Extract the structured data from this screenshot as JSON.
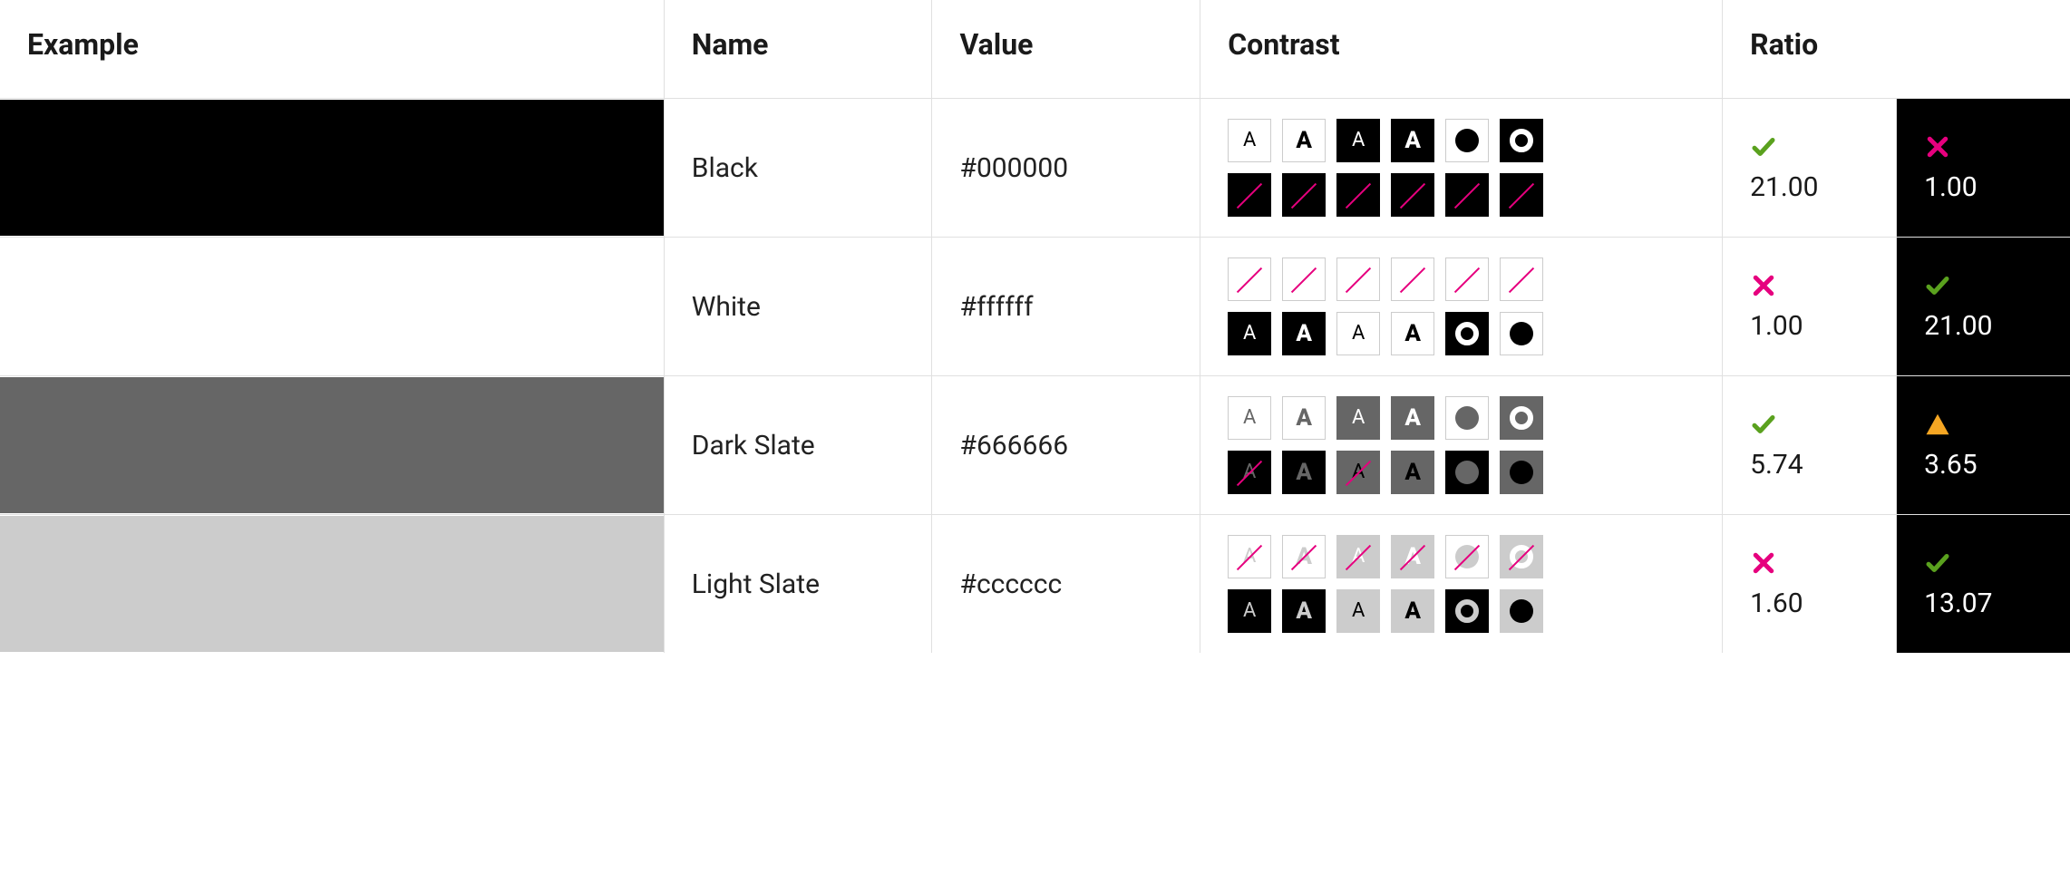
{
  "headers": {
    "example": "Example",
    "name": "Name",
    "value": "Value",
    "contrast": "Contrast",
    "ratio": "Ratio"
  },
  "status_colors": {
    "pass": "#5aa11e",
    "fail": "#e6007e",
    "warn": "#f5a623"
  },
  "companion_bg": "#000000",
  "palette": {
    "white": "#ffffff",
    "black": "#000000"
  },
  "rows": [
    {
      "id": "black",
      "name": "Black",
      "value": "#000000",
      "swatch_hex": "#000000",
      "ratio_light": {
        "value": "21.00",
        "status": "pass"
      },
      "ratio_dark": {
        "value": "1.00",
        "status": "fail"
      },
      "contrast_light": [
        {
          "bg": "#ffffff",
          "fg": "#000000",
          "glyph": "A",
          "slash": false
        },
        {
          "bg": "#ffffff",
          "fg": "#000000",
          "glyph": "A-bold",
          "slash": false
        },
        {
          "bg": "#000000",
          "fg": "#ffffff",
          "glyph": "A",
          "slash": false
        },
        {
          "bg": "#000000",
          "fg": "#ffffff",
          "glyph": "A-bold",
          "slash": false
        },
        {
          "bg": "#ffffff",
          "fg": "#000000",
          "glyph": "dot",
          "slash": false
        },
        {
          "bg": "#000000",
          "fg": "#ffffff",
          "glyph": "ring",
          "slash": false
        }
      ],
      "contrast_dark": [
        {
          "bg": "#000000",
          "fg": "#000000",
          "glyph": "none",
          "slash": true
        },
        {
          "bg": "#000000",
          "fg": "#000000",
          "glyph": "none",
          "slash": true
        },
        {
          "bg": "#000000",
          "fg": "#000000",
          "glyph": "none",
          "slash": true
        },
        {
          "bg": "#000000",
          "fg": "#000000",
          "glyph": "none",
          "slash": true
        },
        {
          "bg": "#000000",
          "fg": "#000000",
          "glyph": "none",
          "slash": true
        },
        {
          "bg": "#000000",
          "fg": "#000000",
          "glyph": "none",
          "slash": true
        }
      ]
    },
    {
      "id": "white",
      "name": "White",
      "value": "#ffffff",
      "swatch_hex": "#ffffff",
      "ratio_light": {
        "value": "1.00",
        "status": "fail"
      },
      "ratio_dark": {
        "value": "21.00",
        "status": "pass"
      },
      "contrast_light": [
        {
          "bg": "#ffffff",
          "fg": "#ffffff",
          "glyph": "none",
          "slash": true
        },
        {
          "bg": "#ffffff",
          "fg": "#ffffff",
          "glyph": "none",
          "slash": true
        },
        {
          "bg": "#ffffff",
          "fg": "#ffffff",
          "glyph": "none",
          "slash": true
        },
        {
          "bg": "#ffffff",
          "fg": "#ffffff",
          "glyph": "none",
          "slash": true
        },
        {
          "bg": "#ffffff",
          "fg": "#ffffff",
          "glyph": "none",
          "slash": true
        },
        {
          "bg": "#ffffff",
          "fg": "#ffffff",
          "glyph": "none",
          "slash": true
        }
      ],
      "contrast_dark": [
        {
          "bg": "#000000",
          "fg": "#ffffff",
          "glyph": "A",
          "slash": false
        },
        {
          "bg": "#000000",
          "fg": "#ffffff",
          "glyph": "A-bold",
          "slash": false
        },
        {
          "bg": "#ffffff",
          "fg": "#000000",
          "glyph": "A",
          "slash": false
        },
        {
          "bg": "#ffffff",
          "fg": "#000000",
          "glyph": "A-bold",
          "slash": false
        },
        {
          "bg": "#000000",
          "fg": "#ffffff",
          "glyph": "ring",
          "slash": false
        },
        {
          "bg": "#ffffff",
          "fg": "#000000",
          "glyph": "dot",
          "slash": false
        }
      ]
    },
    {
      "id": "dark-slate",
      "name": "Dark Slate",
      "value": "#666666",
      "swatch_hex": "#666666",
      "ratio_light": {
        "value": "5.74",
        "status": "pass"
      },
      "ratio_dark": {
        "value": "3.65",
        "status": "warn"
      },
      "contrast_light": [
        {
          "bg": "#ffffff",
          "fg": "#666666",
          "glyph": "A",
          "slash": false
        },
        {
          "bg": "#ffffff",
          "fg": "#666666",
          "glyph": "A-bold",
          "slash": false
        },
        {
          "bg": "#666666",
          "fg": "#ffffff",
          "glyph": "A",
          "slash": false
        },
        {
          "bg": "#666666",
          "fg": "#ffffff",
          "glyph": "A-bold",
          "slash": false
        },
        {
          "bg": "#ffffff",
          "fg": "#666666",
          "glyph": "dot",
          "slash": false
        },
        {
          "bg": "#666666",
          "fg": "#ffffff",
          "glyph": "ring",
          "slash": false
        }
      ],
      "contrast_dark": [
        {
          "bg": "#000000",
          "fg": "#666666",
          "glyph": "A",
          "slash": true
        },
        {
          "bg": "#000000",
          "fg": "#666666",
          "glyph": "A-bold",
          "slash": false
        },
        {
          "bg": "#666666",
          "fg": "#000000",
          "glyph": "A",
          "slash": true
        },
        {
          "bg": "#666666",
          "fg": "#000000",
          "glyph": "A-bold",
          "slash": false
        },
        {
          "bg": "#000000",
          "fg": "#666666",
          "glyph": "dot",
          "slash": false
        },
        {
          "bg": "#666666",
          "fg": "#000000",
          "glyph": "dot",
          "slash": false
        }
      ]
    },
    {
      "id": "light-slate",
      "name": "Light Slate",
      "value": "#cccccc",
      "swatch_hex": "#cccccc",
      "ratio_light": {
        "value": "1.60",
        "status": "fail"
      },
      "ratio_dark": {
        "value": "13.07",
        "status": "pass"
      },
      "contrast_light": [
        {
          "bg": "#ffffff",
          "fg": "#cccccc",
          "glyph": "A",
          "slash": true
        },
        {
          "bg": "#ffffff",
          "fg": "#cccccc",
          "glyph": "A-bold",
          "slash": true
        },
        {
          "bg": "#cccccc",
          "fg": "#ffffff",
          "glyph": "A",
          "slash": true
        },
        {
          "bg": "#cccccc",
          "fg": "#ffffff",
          "glyph": "A-bold",
          "slash": true
        },
        {
          "bg": "#ffffff",
          "fg": "#cccccc",
          "glyph": "dot",
          "slash": true
        },
        {
          "bg": "#cccccc",
          "fg": "#ffffff",
          "glyph": "ring",
          "slash": true
        }
      ],
      "contrast_dark": [
        {
          "bg": "#000000",
          "fg": "#cccccc",
          "glyph": "A",
          "slash": false
        },
        {
          "bg": "#000000",
          "fg": "#cccccc",
          "glyph": "A-bold",
          "slash": false
        },
        {
          "bg": "#cccccc",
          "fg": "#000000",
          "glyph": "A",
          "slash": false
        },
        {
          "bg": "#cccccc",
          "fg": "#000000",
          "glyph": "A-bold",
          "slash": false
        },
        {
          "bg": "#000000",
          "fg": "#cccccc",
          "glyph": "ring",
          "slash": false
        },
        {
          "bg": "#cccccc",
          "fg": "#000000",
          "glyph": "dot",
          "slash": false
        }
      ]
    }
  ]
}
